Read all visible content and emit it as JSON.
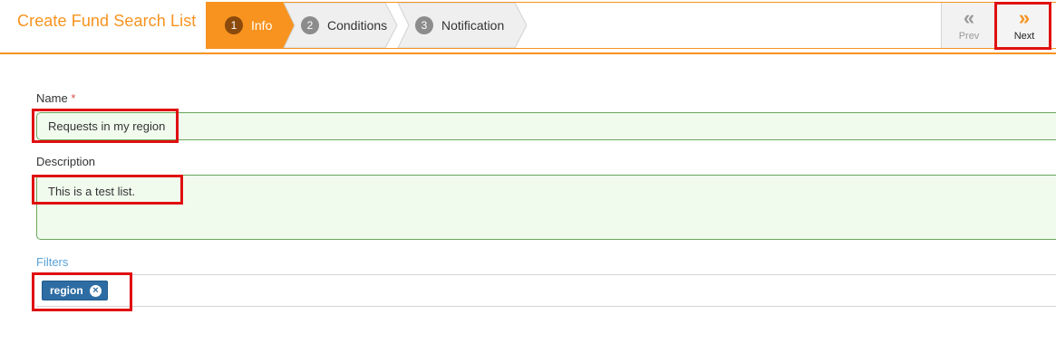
{
  "header": {
    "title": "Create Fund Search List"
  },
  "wizard": {
    "steps": [
      {
        "number": "1",
        "label": "Info",
        "state": "active"
      },
      {
        "number": "2",
        "label": "Conditions",
        "state": "inactive"
      },
      {
        "number": "3",
        "label": "Notification",
        "state": "inactive"
      }
    ],
    "prev": {
      "icon": "double-chevron-left-icon",
      "label": "Prev"
    },
    "next": {
      "icon": "double-chevron-right-icon",
      "label": "Next"
    }
  },
  "form": {
    "name": {
      "label": "Name",
      "required_marker": "*",
      "value": "Requests in my region"
    },
    "description": {
      "label": "Description",
      "value": "This is a test list."
    },
    "filters": {
      "label": "Filters",
      "tags": [
        {
          "label": "region",
          "remove_icon": "close-circle-icon"
        }
      ]
    }
  },
  "colors": {
    "accent": "#f7931e",
    "active_step_number": "#8b4a0c",
    "input_valid_bg": "#f0fbee",
    "input_valid_border": "#6aa65a",
    "filters_label": "#5aa3d8",
    "tag_bg": "#2e6da4",
    "highlight": "#e01010"
  }
}
